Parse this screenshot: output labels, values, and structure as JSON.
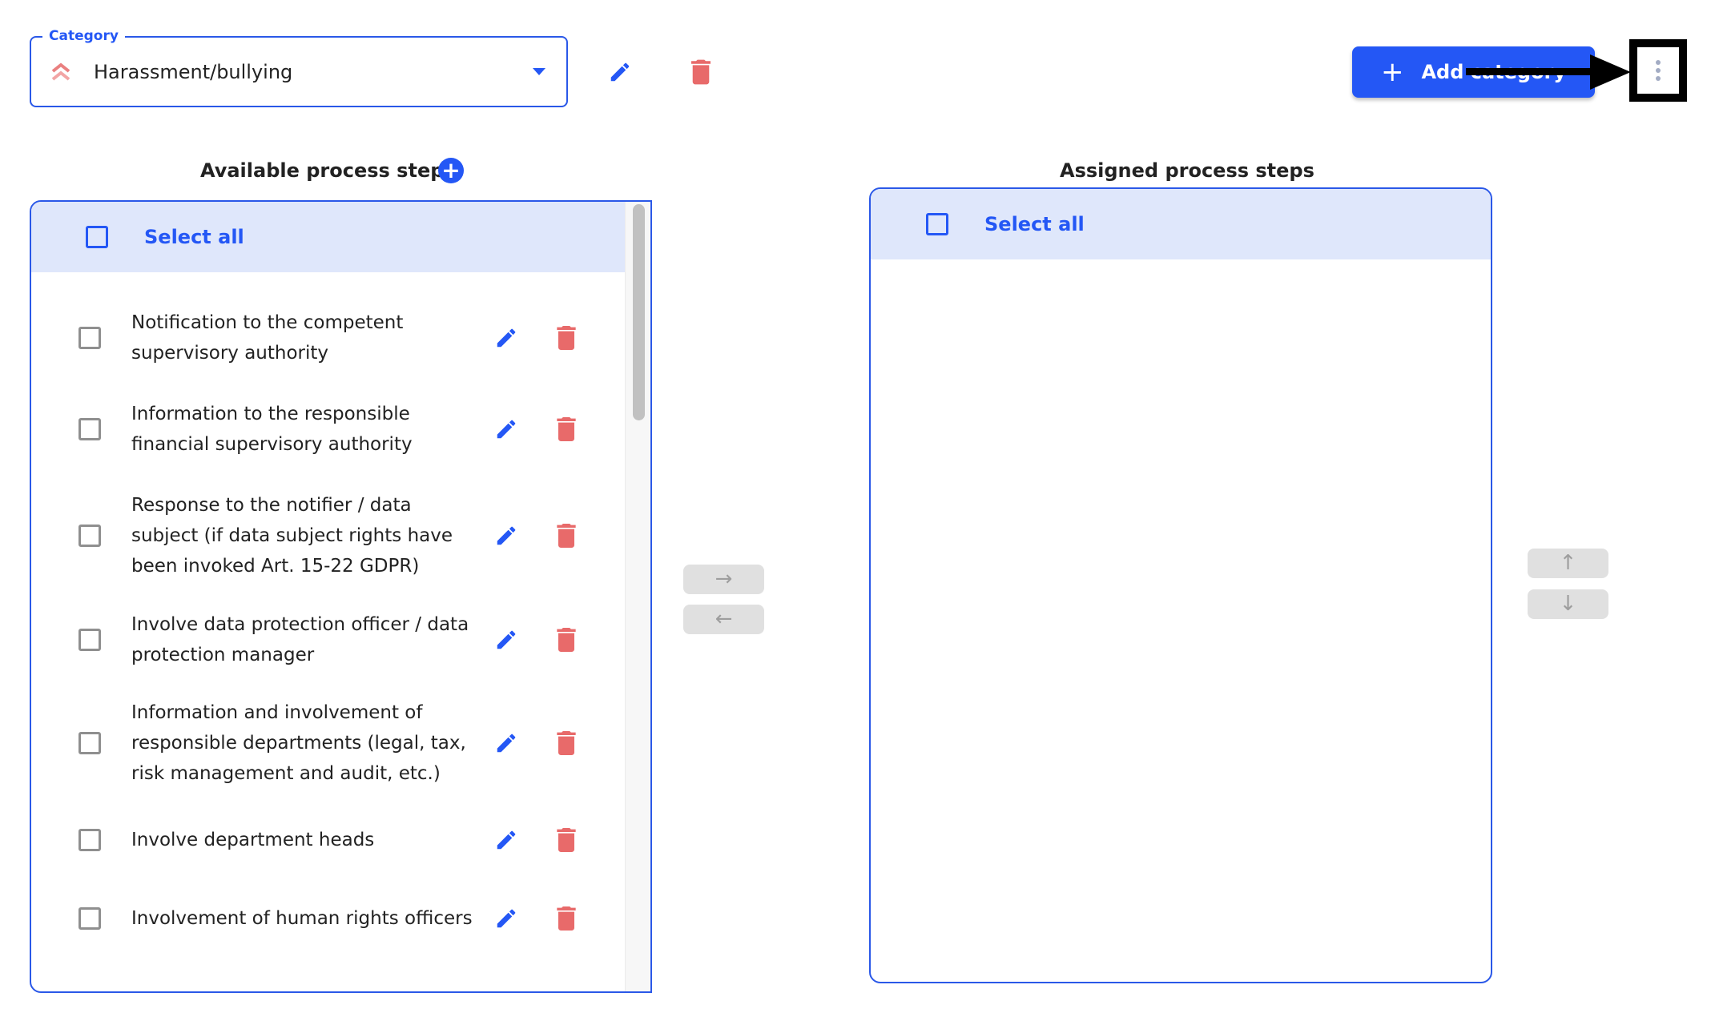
{
  "category_field": {
    "label": "Category",
    "value": "Harassment/bullying",
    "priority_icon": "double-chevron-up-icon",
    "dropdown_icon": "caret-down-icon"
  },
  "toolbar": {
    "edit_icon": "pencil-icon",
    "delete_icon": "trash-icon",
    "add_category_label": "Add category",
    "add_icon": "+",
    "more_icon": "kebab-menu-icon"
  },
  "colors": {
    "accent": "#2457f5",
    "danger": "#e86a6a",
    "select_all_bg": "#dfe7fb",
    "disabled_btn_bg": "#e0e0e0",
    "annotation": "#000000"
  },
  "available": {
    "title": "Available process steps",
    "add_icon": "+",
    "select_all_label": "Select all",
    "steps": [
      {
        "label": "Notification to the competent supervisory authority",
        "checked": false
      },
      {
        "label": "Information to the responsible financial supervisory authority",
        "checked": false
      },
      {
        "label": "Response to the notifier / data subject (if data subject rights have been invoked Art. 15-22 GDPR)",
        "checked": false
      },
      {
        "label": "Involve data protection officer / data protection manager",
        "checked": false
      },
      {
        "label": "Information and involvement of responsible departments (legal, tax, risk management and audit, etc.)",
        "checked": false
      },
      {
        "label": "Involve department heads",
        "checked": false
      },
      {
        "label": "Involvement of human rights officers",
        "checked": false
      }
    ]
  },
  "assigned": {
    "title": "Assigned process steps",
    "select_all_label": "Select all",
    "steps": []
  },
  "transfer": {
    "move_right": "→",
    "move_left": "←"
  },
  "ordering": {
    "move_up": "↑",
    "move_down": "↓"
  }
}
